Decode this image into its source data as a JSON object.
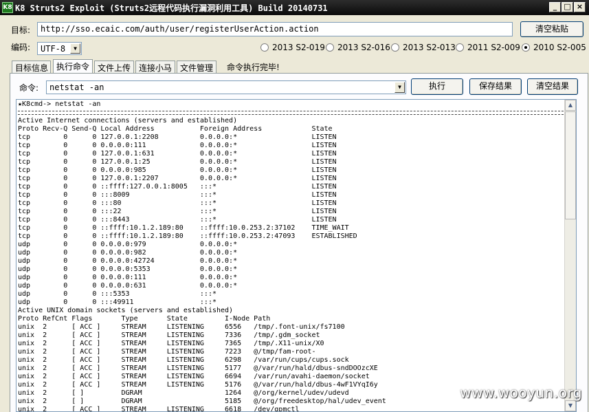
{
  "window": {
    "title": "K8 Struts2 Exploit (Struts2远程代码执行漏洞利用工具) Build 20140731",
    "icon_label": "K8",
    "controls": [
      "minimize-icon",
      "maximize-icon",
      "close-icon"
    ]
  },
  "target": {
    "label": "目标:",
    "value": "http://sso.ecaic.com/auth/user/registerUserAction.action",
    "clear_button": "清空粘贴"
  },
  "encoding": {
    "label": "编码:",
    "value": "UTF-8"
  },
  "exploits": [
    {
      "label": "2013 S2-019",
      "selected": false
    },
    {
      "label": "2013 S2-016",
      "selected": false
    },
    {
      "label": "2013 S2-013",
      "selected": false
    },
    {
      "label": "2011 S2-009",
      "selected": false
    },
    {
      "label": "2010 S2-005",
      "selected": true
    }
  ],
  "tabs": [
    {
      "label": "目标信息",
      "active": false
    },
    {
      "label": "执行命令",
      "active": true
    },
    {
      "label": "文件上传",
      "active": false
    },
    {
      "label": "连接小马",
      "active": false
    },
    {
      "label": "文件管理",
      "active": false
    }
  ],
  "status": "命令执行完毕!",
  "command": {
    "label": "命令:",
    "value": "netstat -an",
    "execute_button": "执行",
    "save_button": "保存结果",
    "clear_button": "清空结果"
  },
  "console": {
    "prompt": "★K8cmd-> netstat -an",
    "lines": [
      "Active Internet connections (servers and established)",
      "Proto Recv-Q Send-Q Local Address           Foreign Address            State",
      "tcp        0      0 127.0.0.1:2208          0.0.0.0:*                  LISTEN",
      "tcp        0      0 0.0.0.0:111             0.0.0.0:*                  LISTEN",
      "tcp        0      0 127.0.0.1:631           0.0.0.0:*                  LISTEN",
      "tcp        0      0 127.0.0.1:25            0.0.0.0:*                  LISTEN",
      "tcp        0      0 0.0.0.0:985             0.0.0.0:*                  LISTEN",
      "tcp        0      0 127.0.0.1:2207          0.0.0.0:*                  LISTEN",
      "tcp        0      0 ::ffff:127.0.0.1:8005   :::*                       LISTEN",
      "tcp        0      0 :::8009                 :::*                       LISTEN",
      "tcp        0      0 :::80                   :::*                       LISTEN",
      "tcp        0      0 :::22                   :::*                       LISTEN",
      "tcp        0      0 :::8443                 :::*                       LISTEN",
      "tcp        0      0 ::ffff:10.1.2.189:80    ::ffff:10.0.253.2:37102    TIME_WAIT",
      "tcp        0      0 ::ffff:10.1.2.189:80    ::ffff:10.0.253.2:47093    ESTABLISHED",
      "udp        0      0 0.0.0.0:979             0.0.0.0:*",
      "udp        0      0 0.0.0.0:982             0.0.0.0:*",
      "udp        0      0 0.0.0.0:42724           0.0.0.0:*",
      "udp        0      0 0.0.0.0:5353            0.0.0.0:*",
      "udp        0      0 0.0.0.0:111             0.0.0.0:*",
      "udp        0      0 0.0.0.0:631             0.0.0.0:*",
      "udp        0      0 :::5353                 :::*",
      "udp        0      0 :::49911                :::*",
      "Active UNIX domain sockets (servers and established)",
      "Proto RefCnt Flags       Type       State         I-Node Path",
      "unix  2      [ ACC ]     STREAM     LISTENING     6556   /tmp/.font-unix/fs7100",
      "unix  2      [ ACC ]     STREAM     LISTENING     7336   /tmp/.gdm_socket",
      "unix  2      [ ACC ]     STREAM     LISTENING     7365   /tmp/.X11-unix/X0",
      "unix  2      [ ACC ]     STREAM     LISTENING     7223   @/tmp/fam-root-",
      "unix  2      [ ACC ]     STREAM     LISTENING     6298   /var/run/cups/cups.sock",
      "unix  2      [ ACC ]     STREAM     LISTENING     5177   @/var/run/hald/dbus-sndDOOzcXE",
      "unix  2      [ ACC ]     STREAM     LISTENING     6694   /var/run/avahi-daemon/socket",
      "unix  2      [ ACC ]     STREAM     LISTENING     5176   @/var/run/hald/dbus-4wF1VYqI6y",
      "unix  2      [ ]         DGRAM                    1264   @/org/kernel/udev/udevd",
      "unix  2      [ ]         DGRAM                    5185   @/org/freedesktop/hal/udev_event",
      "unix  2      [ ACC ]     STREAM     LISTENING     6618   /dev/gpmctl"
    ]
  },
  "watermark": "www.wooyun.org"
}
